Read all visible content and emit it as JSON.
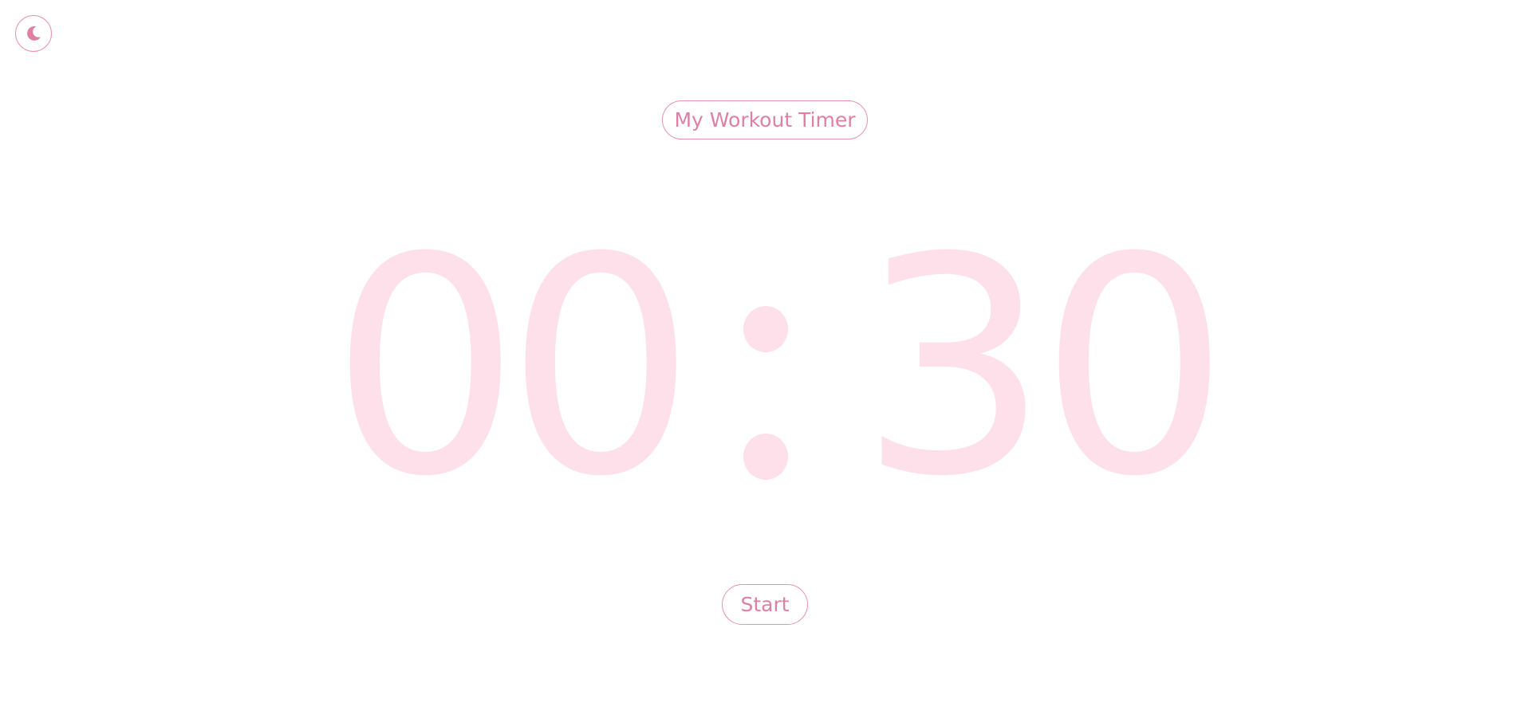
{
  "theme_toggle": {
    "icon": "moon-icon"
  },
  "header": {
    "title": "My Workout Timer"
  },
  "timer": {
    "minutes_tens": "0",
    "minutes_ones": "0",
    "separator": ":",
    "seconds_tens": "3",
    "seconds_ones": "0"
  },
  "controls": {
    "start_label": "Start"
  },
  "colors": {
    "accent": "#e07fa6",
    "border": "#e891b2",
    "digits": "#fde0ea",
    "background": "#ffffff"
  }
}
